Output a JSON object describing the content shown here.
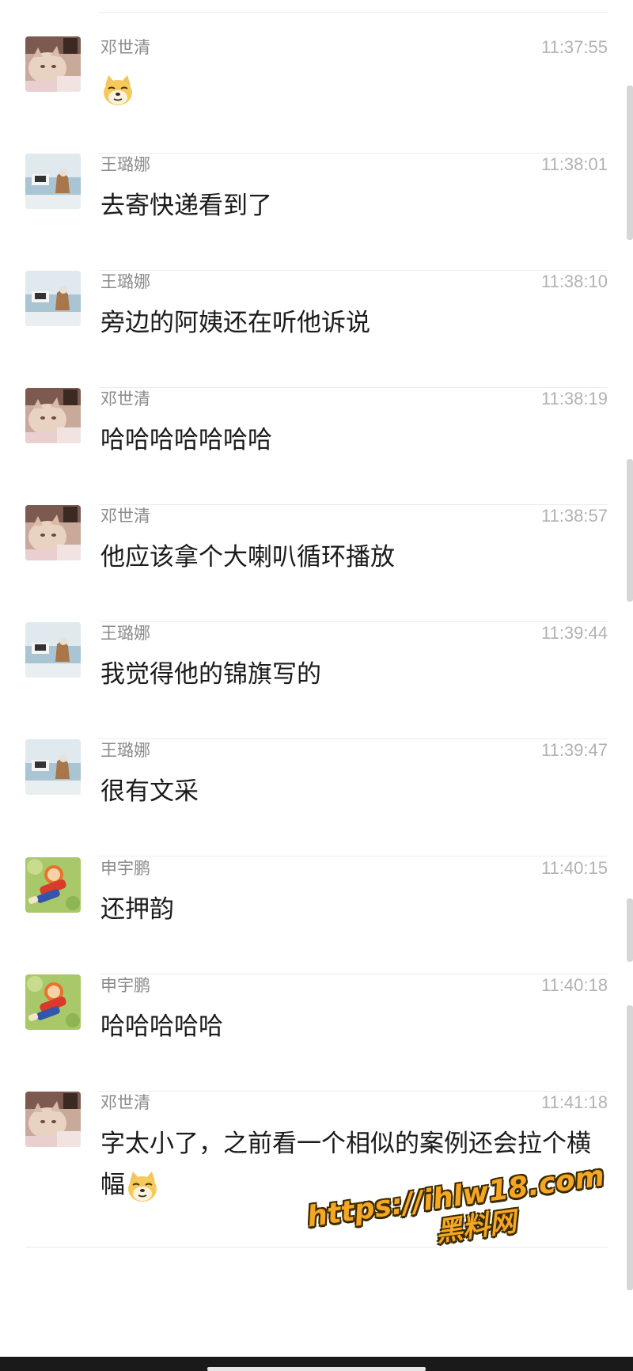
{
  "messages": [
    {
      "sender": "邓世清",
      "avatar": "cat-avatar",
      "time": "11:37:55",
      "text": "",
      "emoji": "doge"
    },
    {
      "sender": "王璐娜",
      "avatar": "seaside-avatar",
      "time": "11:38:01",
      "text": "去寄快递看到了"
    },
    {
      "sender": "王璐娜",
      "avatar": "seaside-avatar",
      "time": "11:38:10",
      "text": "旁边的阿姨还在听他诉说"
    },
    {
      "sender": "邓世清",
      "avatar": "cat-avatar",
      "time": "11:38:19",
      "text": "哈哈哈哈哈哈哈"
    },
    {
      "sender": "邓世清",
      "avatar": "cat-avatar",
      "time": "11:38:57",
      "text": "他应该拿个大喇叭循环播放"
    },
    {
      "sender": "王璐娜",
      "avatar": "seaside-avatar",
      "time": "11:39:44",
      "text": "我觉得他的锦旗写的"
    },
    {
      "sender": "王璐娜",
      "avatar": "seaside-avatar",
      "time": "11:39:47",
      "text": "很有文采"
    },
    {
      "sender": "申宇鹏",
      "avatar": "cartoon-avatar",
      "time": "11:40:15",
      "text": "还押韵"
    },
    {
      "sender": "申宇鹏",
      "avatar": "cartoon-avatar",
      "time": "11:40:18",
      "text": "哈哈哈哈哈"
    },
    {
      "sender": "邓世清",
      "avatar": "cat-avatar",
      "time": "11:41:18",
      "text": "字太小了，之前看一个相似的案例还会拉个横幅",
      "emoji": "doge"
    }
  ],
  "watermark": {
    "line1": "https://ihlw18.com",
    "line2": "黑料网"
  },
  "colors": {
    "name": "#8a8a8a",
    "time": "#b2b2b2",
    "text": "#1b1b1b",
    "divider": "#ececec",
    "watermark": "#f5a623"
  }
}
